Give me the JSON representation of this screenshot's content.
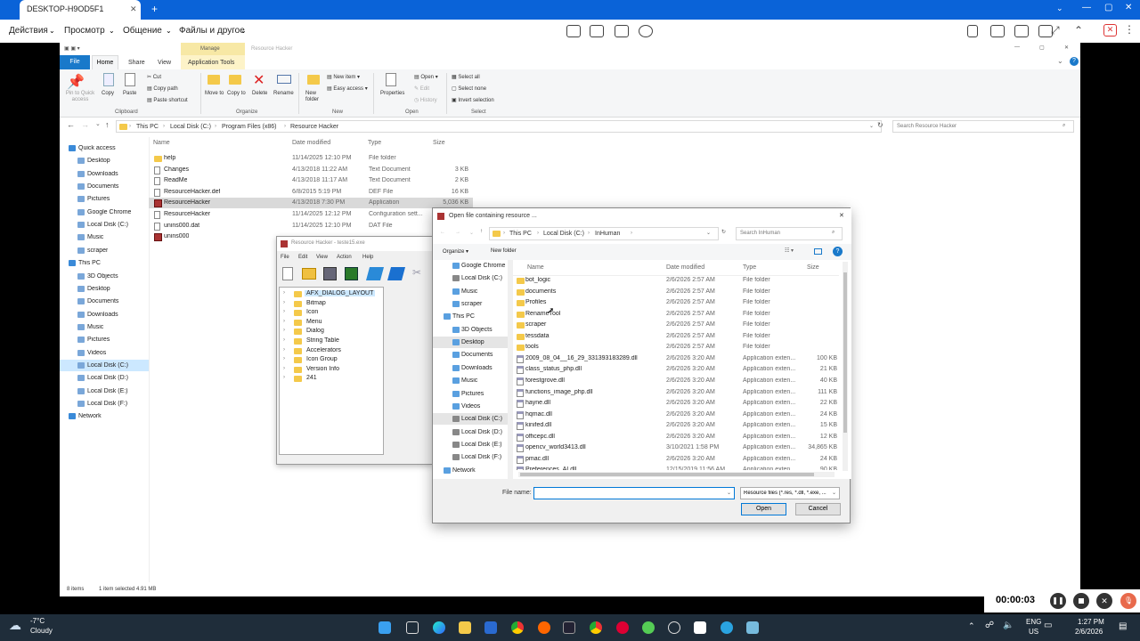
{
  "remote": {
    "tab_title": "DESKTOP-H9OD5F1",
    "menu": [
      "Действия",
      "Просмотр",
      "Общение",
      "Файлы и другое"
    ]
  },
  "explorer": {
    "ribbon_tabs": [
      "File",
      "Home",
      "Share",
      "View",
      "Application Tools"
    ],
    "manage_label": "Manage",
    "window_title": "Resource Hacker",
    "clipboard": {
      "pin": "Pin to Quick access",
      "copy": "Copy",
      "paste": "Paste",
      "cut": "Cut",
      "copy_path": "Copy path",
      "paste_shortcut": "Paste shortcut",
      "group": "Clipboard"
    },
    "organize": {
      "move": "Move to",
      "copy": "Copy to",
      "delete": "Delete",
      "rename": "Rename",
      "group": "Organize"
    },
    "new": {
      "folder": "New folder",
      "item": "New item",
      "easy": "Easy access",
      "group": "New"
    },
    "open": {
      "properties": "Properties",
      "open": "Open",
      "edit": "Edit",
      "history": "History",
      "group": "Open"
    },
    "select": {
      "all": "Select all",
      "none": "Select none",
      "invert": "Invert selection",
      "group": "Select"
    },
    "path": [
      "This PC",
      "Local Disk (C:)",
      "Program Files (x86)",
      "Resource Hacker"
    ],
    "search_placeholder": "Search Resource Hacker",
    "columns": [
      "Name",
      "Date modified",
      "Type",
      "Size"
    ],
    "files": [
      {
        "name": "help",
        "date": "11/14/2025 12:10 PM",
        "type": "File folder",
        "size": "",
        "icon": "folder"
      },
      {
        "name": "Changes",
        "date": "4/13/2018 11:22 AM",
        "type": "Text Document",
        "size": "3 KB",
        "icon": "doc"
      },
      {
        "name": "ReadMe",
        "date": "4/13/2018 11:17 AM",
        "type": "Text Document",
        "size": "2 KB",
        "icon": "doc"
      },
      {
        "name": "ResourceHacker.def",
        "date": "6/8/2015 5:19 PM",
        "type": "DEF File",
        "size": "16 KB",
        "icon": "doc"
      },
      {
        "name": "ResourceHacker",
        "date": "4/13/2018 7:30 PM",
        "type": "Application",
        "size": "5,036 KB",
        "icon": "app"
      },
      {
        "name": "ResourceHacker",
        "date": "11/14/2025 12:12 PM",
        "type": "Configuration sett...",
        "size": "1 KB",
        "icon": "doc"
      },
      {
        "name": "unins000.dat",
        "date": "11/14/2025 12:10 PM",
        "type": "DAT File",
        "size": "",
        "icon": "doc"
      },
      {
        "name": "unins000",
        "date": "",
        "type": "",
        "size": "",
        "icon": "app"
      }
    ],
    "sidebar": [
      {
        "label": "Quick access",
        "indent": 0
      },
      {
        "label": "Desktop",
        "indent": 1
      },
      {
        "label": "Downloads",
        "indent": 1
      },
      {
        "label": "Documents",
        "indent": 1
      },
      {
        "label": "Pictures",
        "indent": 1
      },
      {
        "label": "Google Chrome",
        "indent": 1
      },
      {
        "label": "Local Disk (C:)",
        "indent": 1
      },
      {
        "label": "Music",
        "indent": 1
      },
      {
        "label": "scraper",
        "indent": 1
      },
      {
        "label": "This PC",
        "indent": 0
      },
      {
        "label": "3D Objects",
        "indent": 1
      },
      {
        "label": "Desktop",
        "indent": 1
      },
      {
        "label": "Documents",
        "indent": 1
      },
      {
        "label": "Downloads",
        "indent": 1
      },
      {
        "label": "Music",
        "indent": 1
      },
      {
        "label": "Pictures",
        "indent": 1
      },
      {
        "label": "Videos",
        "indent": 1
      },
      {
        "label": "Local Disk (C:)",
        "indent": 1
      },
      {
        "label": "Local Disk (D:)",
        "indent": 1
      },
      {
        "label": "Local Disk (E:)",
        "indent": 1
      },
      {
        "label": "Local Disk (F:)",
        "indent": 1
      },
      {
        "label": "Network",
        "indent": 0
      }
    ],
    "status_items": "8 items",
    "status_selected": "1 item selected  4.91 MB"
  },
  "rh": {
    "title": "Resource Hacker - teste15.exe",
    "menu": [
      "File",
      "Edit",
      "View",
      "Action",
      "Help"
    ],
    "tree": [
      "AFX_DIALOG_LAYOUT",
      "Bitmap",
      "Icon",
      "Menu",
      "Dialog",
      "String Table",
      "Accelerators",
      "Icon Group",
      "Version Info",
      "241"
    ]
  },
  "dialog": {
    "title": "Open file containing resource ...",
    "path": [
      "This PC",
      "Local Disk (C:)",
      "InHuman"
    ],
    "search_placeholder": "Search InHuman",
    "organize": "Organize",
    "new_folder": "New folder",
    "nav": [
      "Google Chrome",
      "Local Disk (C:)",
      "Music",
      "scraper",
      "This PC",
      "3D Objects",
      "Desktop",
      "Documents",
      "Downloads",
      "Music",
      "Pictures",
      "Videos",
      "Local Disk (C:)",
      "Local Disk (D:)",
      "Local Disk (E:)",
      "Local Disk (F:)",
      "Network"
    ],
    "columns": [
      "Name",
      "Date modified",
      "Type",
      "Size"
    ],
    "files": [
      {
        "name": "bot_logic",
        "date": "2/6/2026 2:57 AM",
        "type": "File folder",
        "size": "",
        "icon": "folder"
      },
      {
        "name": "documents",
        "date": "2/6/2026 2:57 AM",
        "type": "File folder",
        "size": "",
        "icon": "folder"
      },
      {
        "name": "Profiles",
        "date": "2/6/2026 2:57 AM",
        "type": "File folder",
        "size": "",
        "icon": "folder"
      },
      {
        "name": "RenameTool",
        "date": "2/6/2026 2:57 AM",
        "type": "File folder",
        "size": "",
        "icon": "folder"
      },
      {
        "name": "scraper",
        "date": "2/6/2026 2:57 AM",
        "type": "File folder",
        "size": "",
        "icon": "folder"
      },
      {
        "name": "tessdata",
        "date": "2/6/2026 2:57 AM",
        "type": "File folder",
        "size": "",
        "icon": "folder"
      },
      {
        "name": "tools",
        "date": "2/6/2026 2:57 AM",
        "type": "File folder",
        "size": "",
        "icon": "folder"
      },
      {
        "name": "2009_08_04__16_29_331393183289.dll",
        "date": "2/6/2026 3:20 AM",
        "type": "Application exten...",
        "size": "100 KB",
        "icon": "dll"
      },
      {
        "name": "class_status_php.dll",
        "date": "2/6/2026 3:20 AM",
        "type": "Application exten...",
        "size": "21 KB",
        "icon": "dll"
      },
      {
        "name": "forestgrove.dll",
        "date": "2/6/2026 3:20 AM",
        "type": "Application exten...",
        "size": "40 KB",
        "icon": "dll"
      },
      {
        "name": "functions_image_php.dll",
        "date": "2/6/2026 3:20 AM",
        "type": "Application exten...",
        "size": "111 KB",
        "icon": "dll"
      },
      {
        "name": "hayne.dll",
        "date": "2/6/2026 3:20 AM",
        "type": "Application exten...",
        "size": "22 KB",
        "icon": "dll"
      },
      {
        "name": "hqmac.dll",
        "date": "2/6/2026 3:20 AM",
        "type": "Application exten...",
        "size": "24 KB",
        "icon": "dll"
      },
      {
        "name": "kinifed.dll",
        "date": "2/6/2026 3:20 AM",
        "type": "Application exten...",
        "size": "15 KB",
        "icon": "dll"
      },
      {
        "name": "officepc.dll",
        "date": "2/6/2026 3:20 AM",
        "type": "Application exten...",
        "size": "12 KB",
        "icon": "dll"
      },
      {
        "name": "opencv_world3413.dll",
        "date": "3/10/2021 1:58 PM",
        "type": "Application exten...",
        "size": "34,865 KB",
        "icon": "dll"
      },
      {
        "name": "pmac.dll",
        "date": "2/6/2026 3:20 AM",
        "type": "Application exten...",
        "size": "24 KB",
        "icon": "dll"
      },
      {
        "name": "Preferences_AI.dll",
        "date": "12/15/2019 11:56 AM",
        "type": "Application exten...",
        "size": "90 KB",
        "icon": "dll"
      }
    ],
    "filename_label": "File name:",
    "filename_value": "",
    "filter": "Resource files (*.res, *.dll, *.exe, ...",
    "open": "Open",
    "cancel": "Cancel"
  },
  "recorder": {
    "time": "00:00:03"
  },
  "taskbar": {
    "weather_temp": "-7°C",
    "weather_desc": "Cloudy",
    "lang": "ENG",
    "region": "US",
    "time": "1:27 PM",
    "date": "2/6/2026"
  },
  "colors": {
    "accent": "#0a63d8",
    "selection": "#cce8ff",
    "taskbar": "#1f2d3a"
  }
}
